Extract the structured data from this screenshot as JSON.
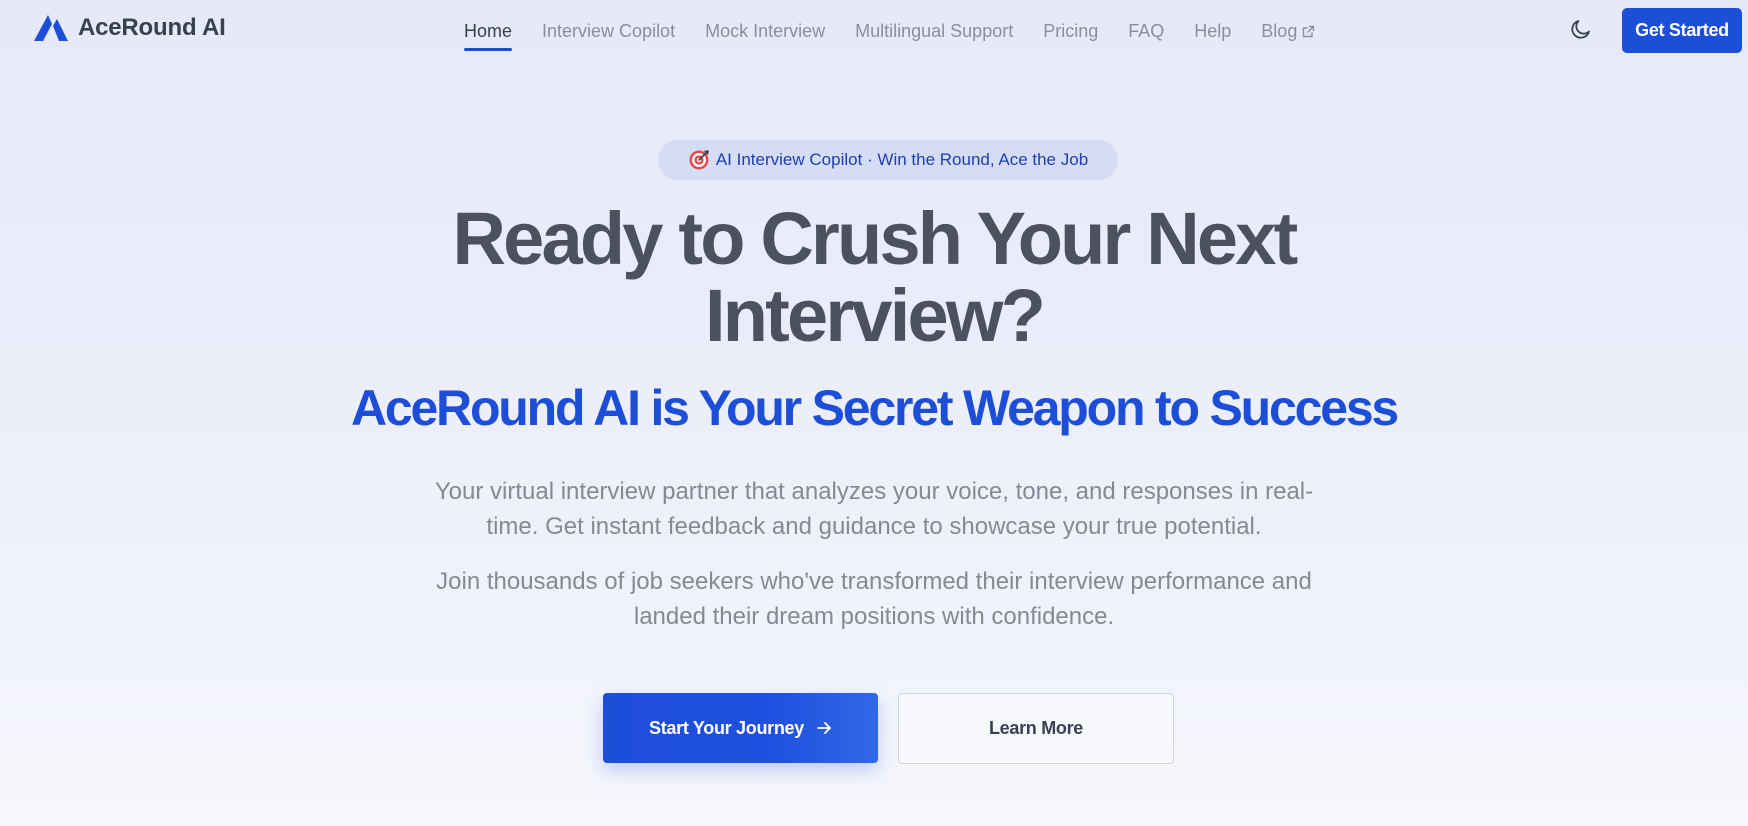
{
  "brand": {
    "name": "AceRound AI",
    "logo_icon": "triangle-logo-icon",
    "accent_color": "#1d4ed8"
  },
  "nav": {
    "links": [
      {
        "label": "Home",
        "active": true
      },
      {
        "label": "Interview Copilot",
        "active": false
      },
      {
        "label": "Mock Interview",
        "active": false
      },
      {
        "label": "Multilingual Support",
        "active": false
      },
      {
        "label": "Pricing",
        "active": false
      },
      {
        "label": "FAQ",
        "active": false
      },
      {
        "label": "Help",
        "active": false
      },
      {
        "label": "Blog",
        "active": false,
        "external": true,
        "icon": "external-link-icon"
      }
    ],
    "theme_toggle_icon": "moon-icon",
    "cta_label": "Get Started"
  },
  "hero": {
    "badge_icon": "target-icon",
    "badge_text": "AI Interview Copilot · Win the Round, Ace the Job",
    "headline_line1": "Ready to Crush Your Next",
    "headline_line2": "Interview?",
    "subheadline": "AceRound AI is Your Secret Weapon to Success",
    "paragraph_1": "Your virtual interview partner that analyzes your voice, tone, and responses in real-time. Get instant feedback and guidance to showcase your true potential.",
    "paragraph_2": "Join thousands of job seekers who've transformed their interview performance and landed their dream positions with confidence.",
    "primary_button_label": "Start Your Journey",
    "primary_button_icon": "arrow-right-icon",
    "secondary_button_label": "Learn More"
  }
}
